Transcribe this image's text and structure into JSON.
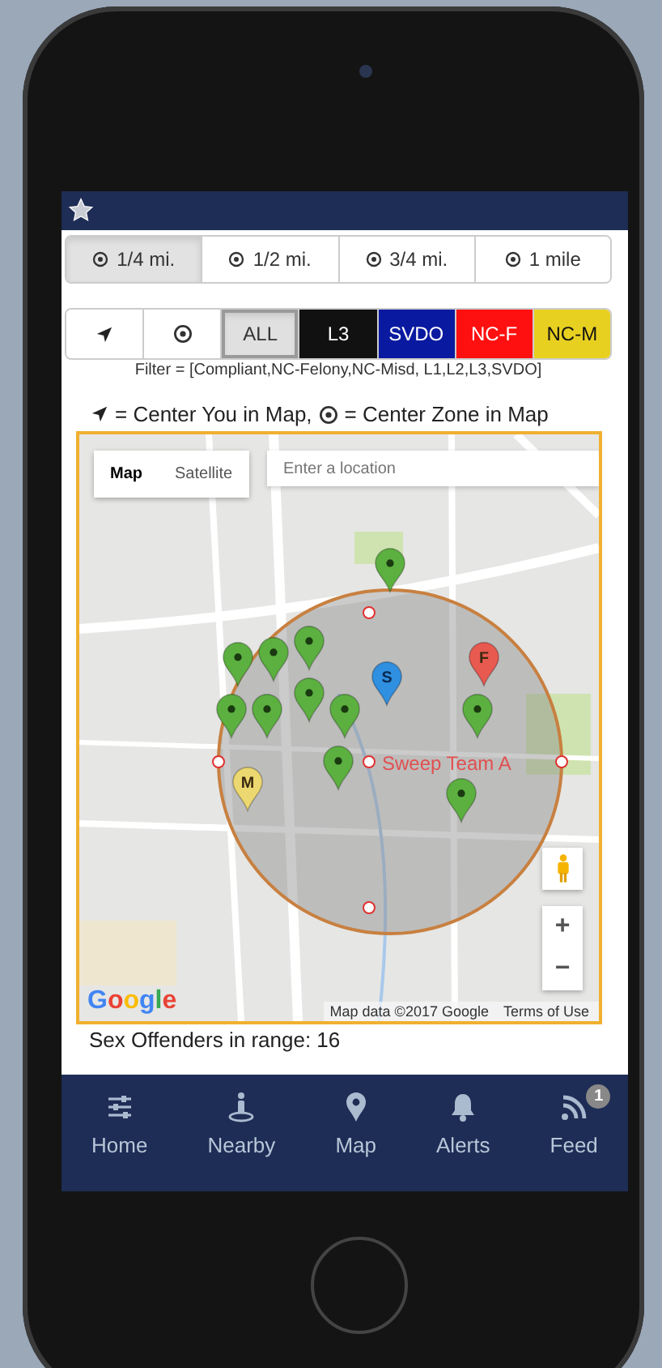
{
  "distance_tabs": [
    {
      "label": "1/4 mi.",
      "selected": true
    },
    {
      "label": "1/2 mi.",
      "selected": false
    },
    {
      "label": "3/4 mi.",
      "selected": false
    },
    {
      "label": "1 mile",
      "selected": false
    }
  ],
  "filter_buttons": [
    {
      "kind": "locate",
      "selected": false
    },
    {
      "kind": "center",
      "selected": false
    },
    {
      "kind": "text",
      "label": "ALL",
      "selected": true
    },
    {
      "kind": "text",
      "label": "L3",
      "color": "#111111",
      "selected": false
    },
    {
      "kind": "text",
      "label": "SVDO",
      "color": "#0a1aa0",
      "selected": false
    },
    {
      "kind": "text",
      "label": "NC-F",
      "color": "#ff1010",
      "selected": false
    },
    {
      "kind": "text",
      "label": "NC-M",
      "color": "#e8d020",
      "selected": false
    }
  ],
  "filter_text": "Filter = [Compliant,NC-Felony,NC-Misd, L1,L2,L3,SVDO]",
  "legend": {
    "locate_text": "= Center You in Map,",
    "center_text": "= Center Zone in Map"
  },
  "map": {
    "type_buttons": [
      {
        "label": "Map",
        "selected": true
      },
      {
        "label": "Satellite",
        "selected": false
      }
    ],
    "search": {
      "placeholder": "Enter a location"
    },
    "zone_label": "Sweep Team A",
    "markers": [
      {
        "color": "#5cb040"
      },
      {
        "color": "#5cb040"
      },
      {
        "color": "#5cb040"
      },
      {
        "color": "#5cb040"
      },
      {
        "color": "#5cb040"
      },
      {
        "color": "#5cb040"
      },
      {
        "color": "#5cb040"
      },
      {
        "color": "#5cb040"
      },
      {
        "color": "#5cb040"
      },
      {
        "color": "#5cb040"
      },
      {
        "color": "#5cb040"
      },
      {
        "label": "S",
        "color": "#2f8fe0"
      },
      {
        "label": "F",
        "color": "#e85a50"
      },
      {
        "label": "M",
        "color": "#ecd870"
      }
    ],
    "zoom_in": "+",
    "zoom_out": "−",
    "logo": "Google",
    "attribution": "Map data ©2017 Google",
    "terms": "Terms of Use"
  },
  "count_text": "Sex Offenders in range: 16",
  "nav": [
    {
      "kind": "home",
      "label": "Home"
    },
    {
      "kind": "nearby",
      "label": "Nearby"
    },
    {
      "kind": "map",
      "label": "Map"
    },
    {
      "kind": "alerts",
      "label": "Alerts"
    },
    {
      "kind": "feed",
      "label": "Feed",
      "badge": "1"
    }
  ]
}
